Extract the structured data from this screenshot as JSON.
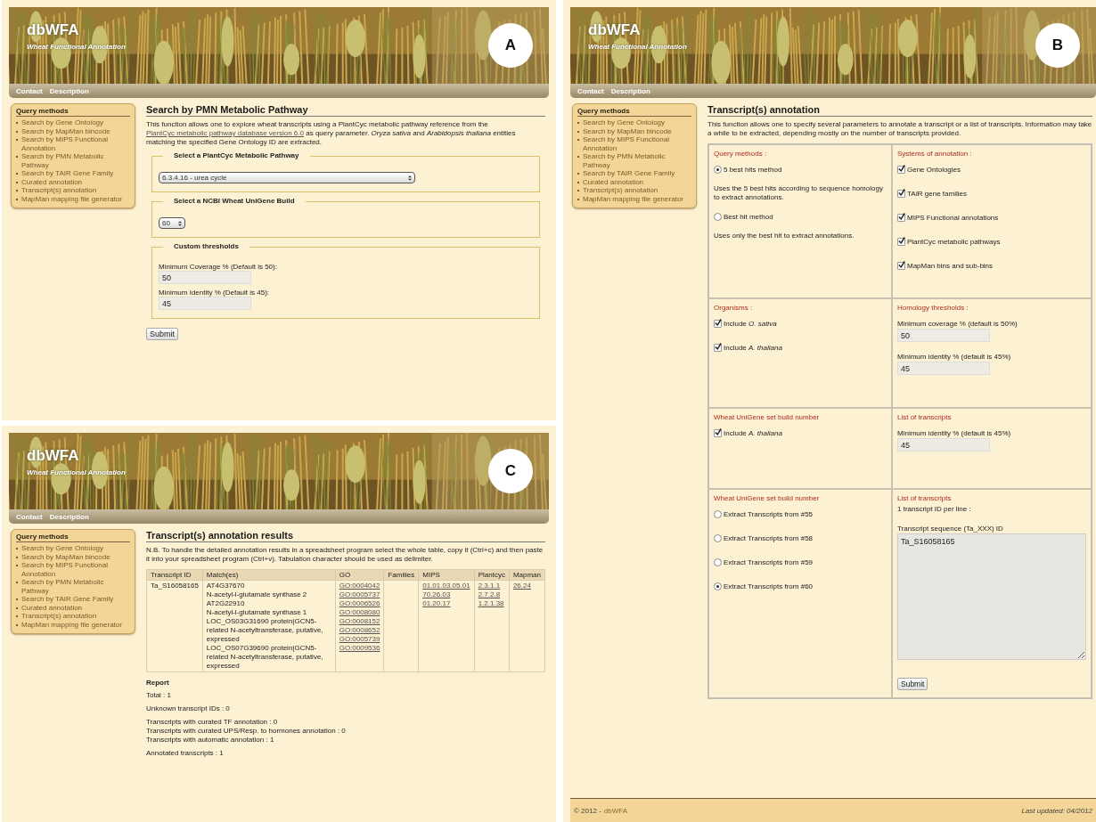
{
  "panels": [
    {
      "label": "A",
      "kind": "pathway_search",
      "header": {
        "title": "dbWFA",
        "subtitle": "Wheat Functional Annotation"
      },
      "nav": [
        "Contact",
        "Description"
      ],
      "sidebar": {
        "title": "Query methods",
        "items": [
          "Search by Gene Ontology",
          "Search by MapMan bincode",
          "Search by MIPS Functional Annotation",
          "Search by PMN Metabolic Pathway",
          "Search by TAIR Gene Family",
          "Curated annotation",
          "Transcript(s) annotation",
          "MapMan mapping file generator"
        ]
      },
      "page": {
        "title": "Search by PMN Metabolic Pathway",
        "description": {
          "before": "This function allows one to explore wheat transcripts using a PlantCyc metabolic pathway reference from the",
          "link": "PlantCyc metabolic pathway database version 6.0",
          "after": "as query parameter. *Oryza sativa* and *Arabidopsis thaliana* entities matching the specified Gene Ontology ID are extracted."
        },
        "fieldsets": [
          {
            "kind": "wide_select",
            "legend": "Select a PlantCyc Metabolic Pathway",
            "value": "6.3.4.16 - urea cycle"
          },
          {
            "kind": "small_select",
            "legend": "Select a NCBI Wheat UniGene Build",
            "value": "60"
          },
          {
            "kind": "thresholds",
            "legend": "Custom thresholds",
            "fields": [
              {
                "label": "Minimum Coverage % (Default is 50):",
                "value": "50"
              },
              {
                "label": "Minimum Identity % (Default is 45):",
                "value": "45"
              }
            ]
          }
        ],
        "button": "Submit"
      }
    },
    {
      "label": "B",
      "kind": "transcript_annotation",
      "header": {
        "title": "dbWFA",
        "subtitle": "Wheat Functional Annotation"
      },
      "nav": [
        "Contact",
        "Description"
      ],
      "sidebar": {
        "title": "Query methods",
        "items": [
          "Search by Gene Ontology",
          "Search by MapMan bincode",
          "Search by MIPS Functional Annotation",
          "Search by PMN Metabolic Pathway",
          "Search by TAIR Gene Family",
          "Curated annotation",
          "Transcript(s) annotation",
          "MapMan mapping file generator"
        ]
      },
      "page": {
        "title": "Transcript(s) annotation",
        "description": "This function allows one to specify several parameters to annotate a transcript or a list of transcripts. Information may take a while to be extracted, depending mostly on the number of transcripts provided.",
        "cells": [
          {
            "heading": "Query methods :",
            "items": [
              {
                "kind": "radio",
                "label": "5 best hits method",
                "selected": true
              },
              {
                "kind": "text",
                "text": "Uses the 5 best hits according to sequence homology to extract annotations."
              },
              {
                "kind": "radio",
                "label": "Best hit method",
                "selected": false
              },
              {
                "kind": "text",
                "text": "Uses only the best hit to extract annotations."
              }
            ]
          },
          {
            "heading": "Systems of annotation :",
            "items": [
              {
                "kind": "checkbox",
                "label": "Gene Ontologies",
                "checked": true
              },
              {
                "kind": "checkbox",
                "label": "TAIR gene families",
                "checked": true
              },
              {
                "kind": "checkbox",
                "label": "MIPS Functional annotations",
                "checked": true
              },
              {
                "kind": "checkbox",
                "label": "PlantCyc metabolic pathways",
                "checked": true
              },
              {
                "kind": "checkbox",
                "label": "MapMan bins and sub-bins",
                "checked": true
              }
            ]
          },
          {
            "heading": "Organisms :",
            "items": [
              {
                "kind": "checkbox",
                "label": "Include *O. sativa*",
                "checked": true
              },
              {
                "kind": "checkbox",
                "label": "Include *A. thaliana*",
                "checked": true
              }
            ]
          },
          {
            "heading": "Homology thresholds :",
            "items": [
              {
                "kind": "field",
                "label": "Minimum coverage % (default is 50%)",
                "value": "50"
              },
              {
                "kind": "field",
                "label": "Minimum identity % (default is 45%)",
                "value": "45"
              }
            ]
          },
          {
            "heading": "Wheat UniGene set build number",
            "items": [
              {
                "kind": "checkbox",
                "label": "Include *A. thaliana*",
                "checked": true
              }
            ]
          },
          {
            "heading": "List of transcripts",
            "items": [
              {
                "kind": "field",
                "label": "Minimum identity % (default is 45%)",
                "value": "45"
              }
            ]
          },
          {
            "heading": "Wheat UniGene set build number",
            "items": [
              {
                "kind": "radio",
                "label": "Extract Transcripts from #55",
                "selected": false
              },
              {
                "kind": "radio",
                "label": "Extract Transcripts from #58",
                "selected": false
              },
              {
                "kind": "radio",
                "label": "Extract Transcripts from #59",
                "selected": false
              },
              {
                "kind": "radio",
                "label": "Extract Transcripts from #60",
                "selected": true
              }
            ]
          },
          {
            "heading": "List of transcripts",
            "items": [
              {
                "kind": "text",
                "text": "1 transcript ID per line :"
              },
              {
                "kind": "textarea",
                "label": "Transcript sequence (Ta_XXX) ID",
                "value": "Ta_S16058165"
              },
              {
                "kind": "button",
                "label": "Submit"
              }
            ]
          }
        ],
        "footer": {
          "copyright": "© 2012 -",
          "link": "dbWFA",
          "updated": "Last updated: 04/2012"
        }
      }
    },
    {
      "label": "C",
      "kind": "results",
      "header": {
        "title": "dbWFA",
        "subtitle": "Wheat Functional Annotation"
      },
      "nav": [
        "Contact",
        "Description"
      ],
      "sidebar": {
        "title": "Query methods",
        "items": [
          "Search by Gene Ontology",
          "Search by MapMan bincode",
          "Search by MIPS Functional Annotation",
          "Search by PMN Metabolic Pathway",
          "Search by TAIR Gene Family",
          "Curated annotation",
          "Transcript(s) annotation",
          "MapMan mapping file generator"
        ]
      },
      "page": {
        "title": "Transcript(s) annotation results",
        "note": "N.B. To handle the detailed annotation results in a spreadsheet program select the whole table, copy it (Ctrl+c) and then paste it into your spreadsheet program (Ctrl+v). Tabulation character should be used as delimiter.",
        "table": {
          "columns": [
            "Transcript ID",
            "Match(es)",
            "GO",
            "Families",
            "MIPS",
            "Plantcyc",
            "Mapman"
          ],
          "rows": [
            {
              "cells": [
                {
                  "kind": "text",
                  "lines": [
                    "Ta_S16058165"
                  ]
                },
                {
                  "kind": "text",
                  "lines": [
                    "AT4G37670",
                    "N-acetyl-l-glutamate synthase 2",
                    "AT2G22910",
                    "N-acetyl-l-glutamate synthase 1",
                    "LOC_OS03G31690 protein|GCN5-related N-acetyltransferase, putative, expressed",
                    "LOC_OS07G39690 protein|GCN5-related N-acetyltransferase, putative, expressed"
                  ]
                },
                {
                  "kind": "links",
                  "lines": [
                    "GO:0004042",
                    "GO:0005737",
                    "GO:0006526",
                    "GO:0008080",
                    "GO:0008152",
                    "GO:0008652",
                    "GO:0005739",
                    "GO:0009536"
                  ]
                },
                {
                  "kind": "text"
                },
                {
                  "kind": "links",
                  "lines": [
                    "01.01.03.05.01",
                    "70.26.03",
                    "01.20.17"
                  ]
                },
                {
                  "kind": "links",
                  "lines": [
                    "2.3.1.1",
                    "2.7.2.8",
                    "1.2.1.38"
                  ]
                },
                {
                  "kind": "links",
                  "lines": [
                    "26.24"
                  ]
                }
              ]
            }
          ]
        },
        "report": {
          "title": "Report",
          "groups": [
            [
              "Total : 1"
            ],
            [
              "Unknown transcript IDs : 0"
            ],
            [
              "Transcripts with curated TF annotation : 0",
              "Transcripts with curated UPS/Resp. to hormones annotation : 0",
              "Transcripts with automatic annotation : 1"
            ],
            [
              "Annotated transcripts : 1"
            ]
          ]
        }
      }
    }
  ]
}
